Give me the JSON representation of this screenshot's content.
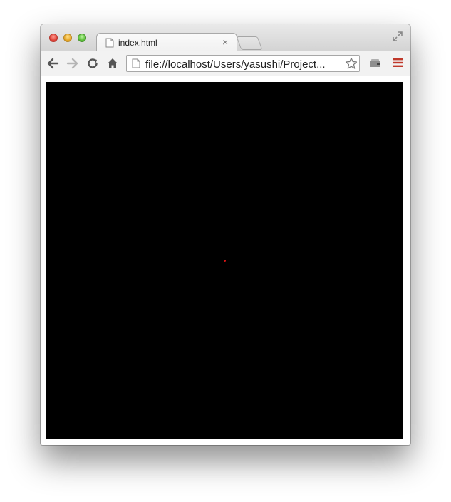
{
  "browser": {
    "tab": {
      "title": "index.html",
      "close_glyph": "×",
      "icon": "document-icon"
    },
    "address_bar": {
      "url": "file://localhost/Users/yasushi/Project..."
    },
    "toolbar_icons": [
      "back-arrow-icon",
      "forward-arrow-icon",
      "reload-icon",
      "home-icon",
      "bookmark-star-icon",
      "extension-icon",
      "menu-icon"
    ],
    "colors": {
      "menu_accent": "#c0392b"
    }
  },
  "page": {
    "canvas": {
      "background": "#000000",
      "dot_color": "#d21414"
    }
  }
}
